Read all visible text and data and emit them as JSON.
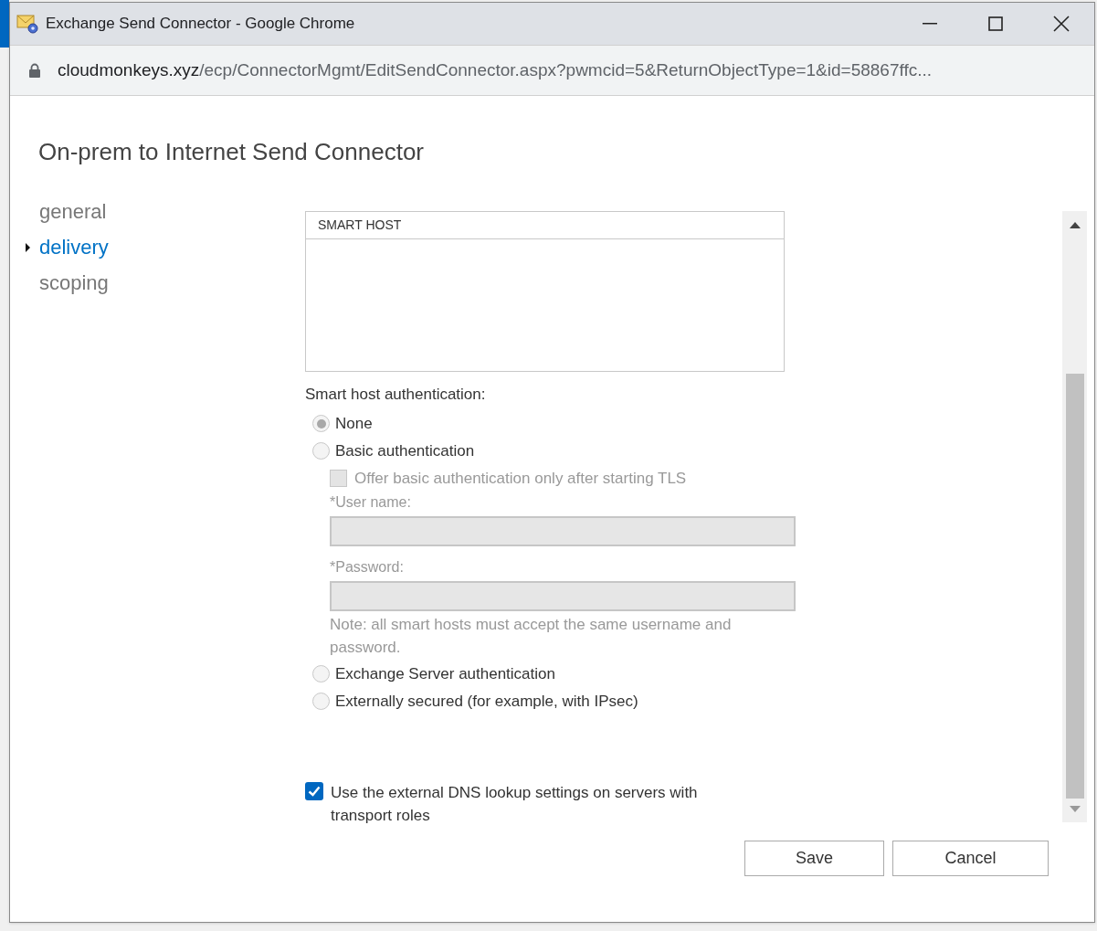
{
  "window": {
    "title": "Exchange Send Connector - Google Chrome"
  },
  "address_bar": {
    "host": "cloudmonkeys.xyz",
    "path": "/ecp/ConnectorMgmt/EditSendConnector.aspx?pwmcid=5&ReturnObjectType=1&id=58867ffc..."
  },
  "heading": "On-prem to Internet Send Connector",
  "nav": [
    {
      "label": "general",
      "selected": false
    },
    {
      "label": "delivery",
      "selected": true
    },
    {
      "label": "scoping",
      "selected": false
    }
  ],
  "smart_host_list": {
    "column": "SMART HOST"
  },
  "auth_label": "Smart host authentication:",
  "auth_options": [
    {
      "kind": "radio",
      "label": "None",
      "selected": true
    },
    {
      "kind": "radio",
      "label": "Basic authentication",
      "selected": false
    },
    {
      "kind": "checkbox",
      "label": "Offer basic authentication only after starting TLS",
      "checked": false,
      "disabled": true
    },
    {
      "kind": "field",
      "label": "*User name:",
      "disabled": true
    },
    {
      "kind": "field",
      "label": "*Password:",
      "disabled": true
    },
    {
      "kind": "note",
      "label": "Note: all smart hosts must accept the same username and password."
    },
    {
      "kind": "radio",
      "label": "Exchange Server authentication",
      "selected": false
    },
    {
      "kind": "radio",
      "label": "Externally secured (for example, with IPsec)",
      "selected": false
    }
  ],
  "dns_option": {
    "label": "Use the external DNS lookup settings on servers with transport roles",
    "checked": true
  },
  "buttons": [
    "Save",
    "Cancel"
  ]
}
